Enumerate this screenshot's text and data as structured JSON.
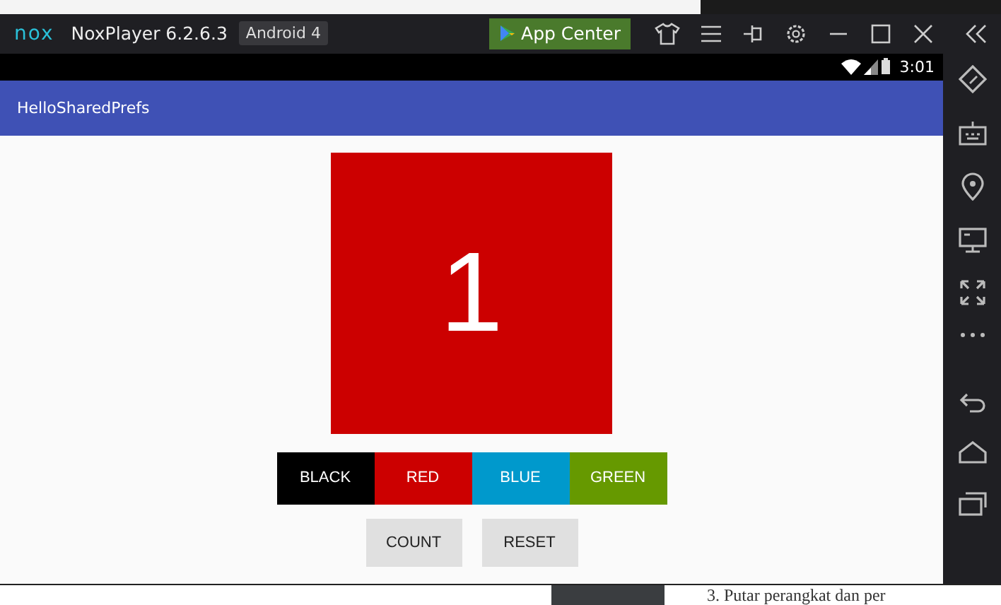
{
  "emulator": {
    "logo": "nox",
    "title": "NoxPlayer 6.2.6.3",
    "version_badge": "Android 4",
    "app_center_button": "App Center"
  },
  "status_bar": {
    "time": "3:01"
  },
  "app_bar": {
    "title": "HelloSharedPrefs"
  },
  "counter": {
    "value": "1",
    "color": "#cc0000"
  },
  "color_buttons": [
    {
      "label": "BLACK",
      "color": "#000000"
    },
    {
      "label": "RED",
      "color": "#cc0000"
    },
    {
      "label": "BLUE",
      "color": "#0099cc"
    },
    {
      "label": "GREEN",
      "color": "#669900"
    }
  ],
  "action_buttons": [
    "COUNT",
    "RESET"
  ],
  "background_text": "3. Putar perangkat dan per"
}
